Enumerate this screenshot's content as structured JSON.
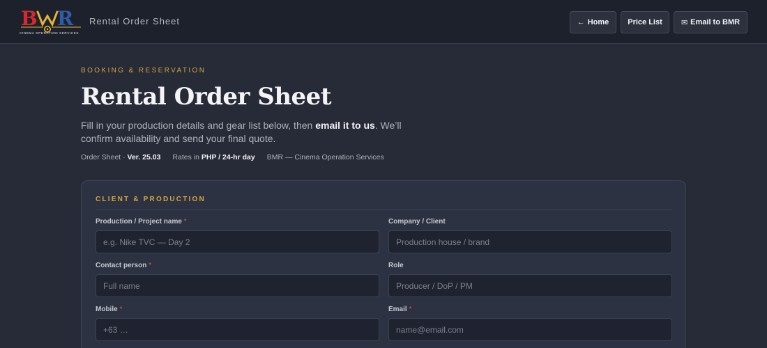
{
  "header": {
    "logo_text": "BMR",
    "logo_tagline": "CINEMA OPERATION SERVICES",
    "title": "Rental Order Sheet",
    "nav": {
      "home": "Home",
      "home_icon": "←",
      "price_list": "Price List",
      "email": "Email to BMR",
      "email_icon": "✉"
    }
  },
  "hero": {
    "eyebrow": "BOOKING & RESERVATION",
    "title": "Rental Order Sheet",
    "intro_pre": "Fill in your production details and gear list below, then ",
    "intro_bold": "email it to us",
    "intro_post": ". We’ll confirm availability and send your final quote.",
    "meta": {
      "sheet_label": "Order Sheet · ",
      "sheet_version": "Ver. 25.03",
      "rates_label": "Rates in ",
      "rates_value": "PHP / 24-hr day",
      "company": "BMR — Cinema Operation Services"
    }
  },
  "form": {
    "section_title": "CLIENT & PRODUCTION",
    "required_mark": "*",
    "fields": {
      "project": {
        "label": "Production / Project name",
        "placeholder": "e.g. Nike TVC — Day 2",
        "value": ""
      },
      "company": {
        "label": "Company / Client",
        "placeholder": "Production house / brand",
        "value": ""
      },
      "contact": {
        "label": "Contact person",
        "placeholder": "Full name",
        "value": ""
      },
      "role": {
        "label": "Role",
        "placeholder": "Producer / DoP / PM",
        "value": ""
      },
      "mobile": {
        "label": "Mobile",
        "placeholder": "+63 …",
        "value": ""
      },
      "email": {
        "label": "Email",
        "placeholder": "name@email.com",
        "value": ""
      }
    }
  },
  "colors": {
    "accent": "#d3a53c",
    "background": "#262b37",
    "topbar": "#1d212b",
    "card": "#2d3242",
    "required": "#d9534f"
  }
}
